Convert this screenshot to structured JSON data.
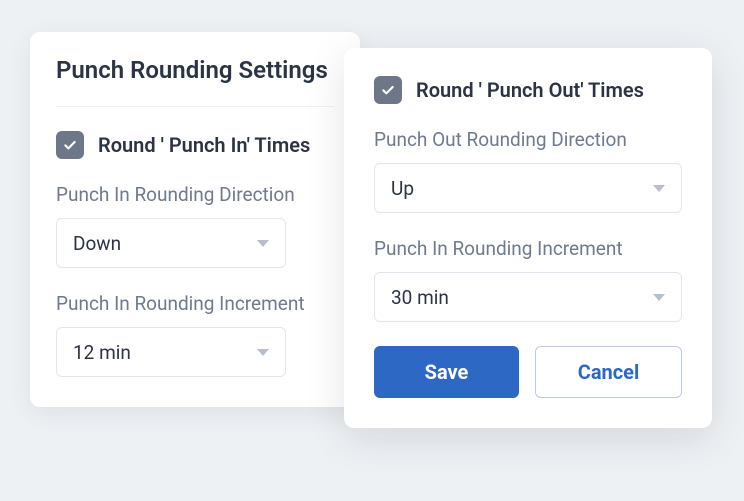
{
  "left_panel": {
    "title": "Punch Rounding Settings",
    "checkbox_label": "Round ' Punch In' Times",
    "direction_label": "Punch In Rounding Direction",
    "direction_value": "Down",
    "increment_label": "Punch In Rounding Increment",
    "increment_value": "12 min"
  },
  "right_panel": {
    "checkbox_label": "Round ' Punch Out' Times",
    "direction_label": "Punch Out Rounding Direction",
    "direction_value": "Up",
    "increment_label": "Punch In Rounding Increment",
    "increment_value": "30 min",
    "save_label": "Save",
    "cancel_label": "Cancel"
  }
}
